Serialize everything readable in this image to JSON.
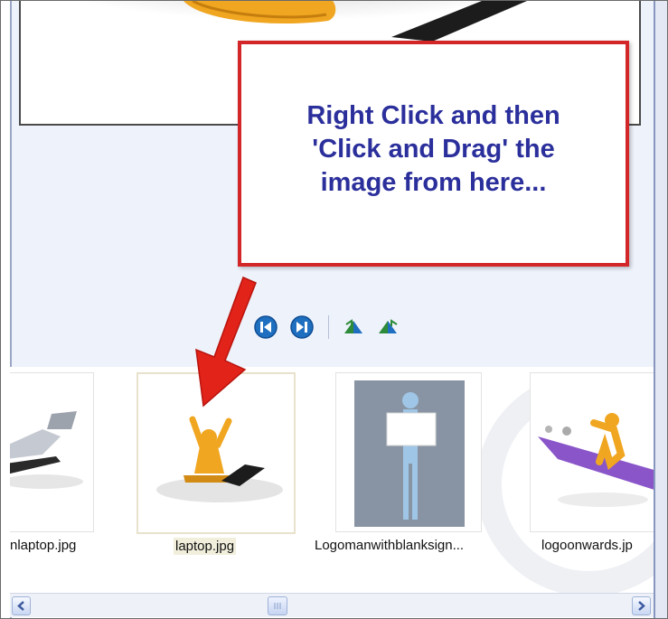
{
  "callout": {
    "text": "Right Click and then 'Click and Drag' the image from here..."
  },
  "toolbar": {
    "buttons": [
      {
        "name": "previous-button",
        "icon": "previous-icon"
      },
      {
        "name": "next-button",
        "icon": "next-icon"
      },
      {
        "name": "rotate-left-button",
        "icon": "rotate-left-icon"
      },
      {
        "name": "rotate-right-button",
        "icon": "rotate-right-icon"
      }
    ]
  },
  "thumbnails": [
    {
      "label": "nlaptop.jpg",
      "selected": false
    },
    {
      "label": "laptop.jpg",
      "selected": true
    },
    {
      "label": "Logomanwithblanksign...",
      "selected": false
    },
    {
      "label": "logoonwards.jp",
      "selected": false
    }
  ],
  "colors": {
    "callout_border": "#d32628",
    "callout_text": "#2b2f9b",
    "arrow": "#e2231a",
    "toolbar_blue": "#1f6fc0",
    "toolbar_green": "#2e8b3a"
  }
}
